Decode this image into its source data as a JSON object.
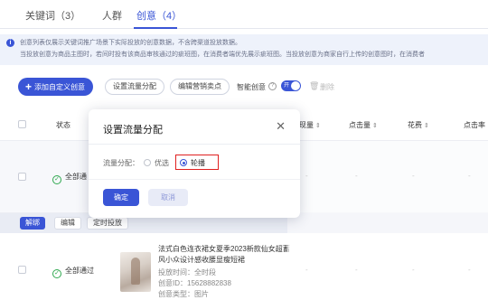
{
  "tabs": [
    {
      "label": "关键词（3）"
    },
    {
      "label": "人群"
    },
    {
      "label": "创意（4）"
    }
  ],
  "notice": {
    "line1": "创意列表仅展示关键词推广场景下实际投放的创意数据，不含跨渠道投放数据。",
    "line2": "当投放创意为商品主图时，若间时投有该商品审核通过的疵班图，在消费者端优先展示疵班图。当投放创意为商家自行上传的创意图时，在消费者"
  },
  "toolbar": {
    "add_label": "添加自定义创意",
    "flow_label": "设置流量分配",
    "edit_label": "编辑营销卖点",
    "smart_label": "智能创意",
    "toggle_label": "开",
    "delete_label": "删除"
  },
  "table": {
    "headers": {
      "status": "状态",
      "col_a": "现量",
      "clicks": "点击量",
      "cost": "花费",
      "ctr": "点击率"
    },
    "row1": {
      "status": "全部通"
    },
    "row2": {
      "status": "全部通过",
      "title": "法式白色连衣裙女夏季2023新款仙女超蓄风小众设计感收腰显瘦短裙",
      "time": "投放时间：全时段",
      "id": "创意ID：15628882838",
      "type": "创意类型：图片"
    },
    "dash": "-"
  },
  "row_actions": {
    "unbind": "解绑",
    "edit": "编辑",
    "schedule": "定时投放"
  },
  "modal": {
    "title": "设置流量分配",
    "field_label": "流量分配：",
    "option_1": "优选",
    "option_2": "轮播",
    "selected": "轮播",
    "ok": "确定",
    "cancel": "取消"
  },
  "colors": {
    "accent": "#3a55d6",
    "success": "#2fa84f",
    "highlight": "#e02020"
  }
}
